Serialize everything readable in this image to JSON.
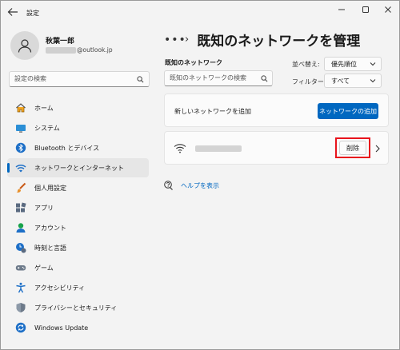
{
  "window": {
    "title": "設定"
  },
  "profile": {
    "name": "秋葉一郎",
    "email_domain": "@outlook.jp"
  },
  "search": {
    "placeholder": "設定の検索"
  },
  "nav": {
    "items": [
      {
        "label": "ホーム",
        "icon": "home-icon"
      },
      {
        "label": "システム",
        "icon": "system-icon"
      },
      {
        "label": "Bluetooth とデバイス",
        "icon": "bluetooth-icon"
      },
      {
        "label": "ネットワークとインターネット",
        "icon": "network-icon",
        "active": true
      },
      {
        "label": "個人用設定",
        "icon": "brush-icon"
      },
      {
        "label": "アプリ",
        "icon": "apps-icon"
      },
      {
        "label": "アカウント",
        "icon": "account-icon"
      },
      {
        "label": "時刻と言語",
        "icon": "time-language-icon"
      },
      {
        "label": "ゲーム",
        "icon": "gaming-icon"
      },
      {
        "label": "アクセシビリティ",
        "icon": "accessibility-icon"
      },
      {
        "label": "プライバシーとセキュリティ",
        "icon": "shield-icon"
      },
      {
        "label": "Windows Update",
        "icon": "windows-update-icon"
      }
    ]
  },
  "main": {
    "breadcrumb_more": "•••",
    "title": "既知のネットワークを管理",
    "section_label": "既知のネットワーク",
    "network_search_placeholder": "既知のネットワークの検索",
    "sort": {
      "label": "並べ替え:",
      "value": "優先順位"
    },
    "filter": {
      "label": "フィルター:",
      "value": "すべて"
    },
    "add_network": {
      "label": "新しいネットワークを追加",
      "button": "ネットワークの追加"
    },
    "network_row": {
      "delete_button": "削除"
    },
    "help_link": "ヘルプを表示"
  },
  "colors": {
    "accent": "#0067c0",
    "highlight_box": "#e8141c"
  }
}
